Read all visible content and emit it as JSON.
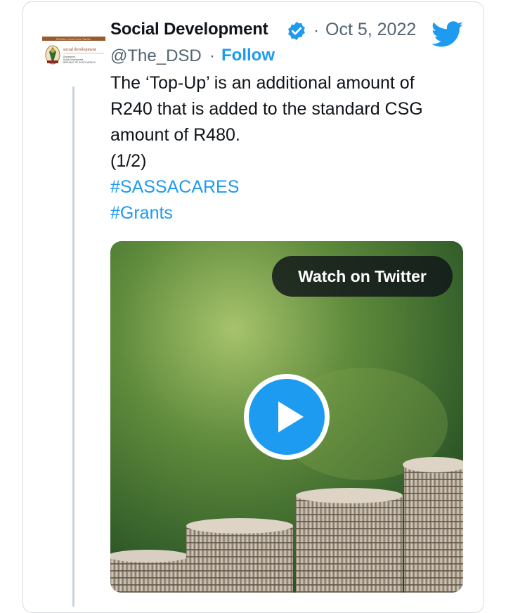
{
  "tweet": {
    "author_name": "Social Development",
    "handle": "@The_DSD",
    "separator": "·",
    "date": "Oct 5, 2022",
    "follow_label": "Follow",
    "text_lines": [
      "The ‘Top-Up’ is an additional amount of",
      "R240 that is added to the standard CSG",
      "amount of R480.",
      "(1/2)"
    ],
    "hashtags": [
      "#SASSACARES",
      "#Grants"
    ]
  },
  "avatar": {
    "banner_text": "Building a Caring Society. Together.",
    "org_text": "social development",
    "sub_lines": [
      "Department:",
      "Social Development",
      "REPUBLIC OF SOUTH AFRICA"
    ]
  },
  "media": {
    "watch_label": "Watch on Twitter"
  },
  "icons": {
    "verified": "verified-badge-icon",
    "brand": "twitter-bird-icon",
    "play": "play-icon"
  },
  "colors": {
    "accent": "#1d9bf0",
    "text": "#0f1419",
    "muted": "#536471"
  }
}
